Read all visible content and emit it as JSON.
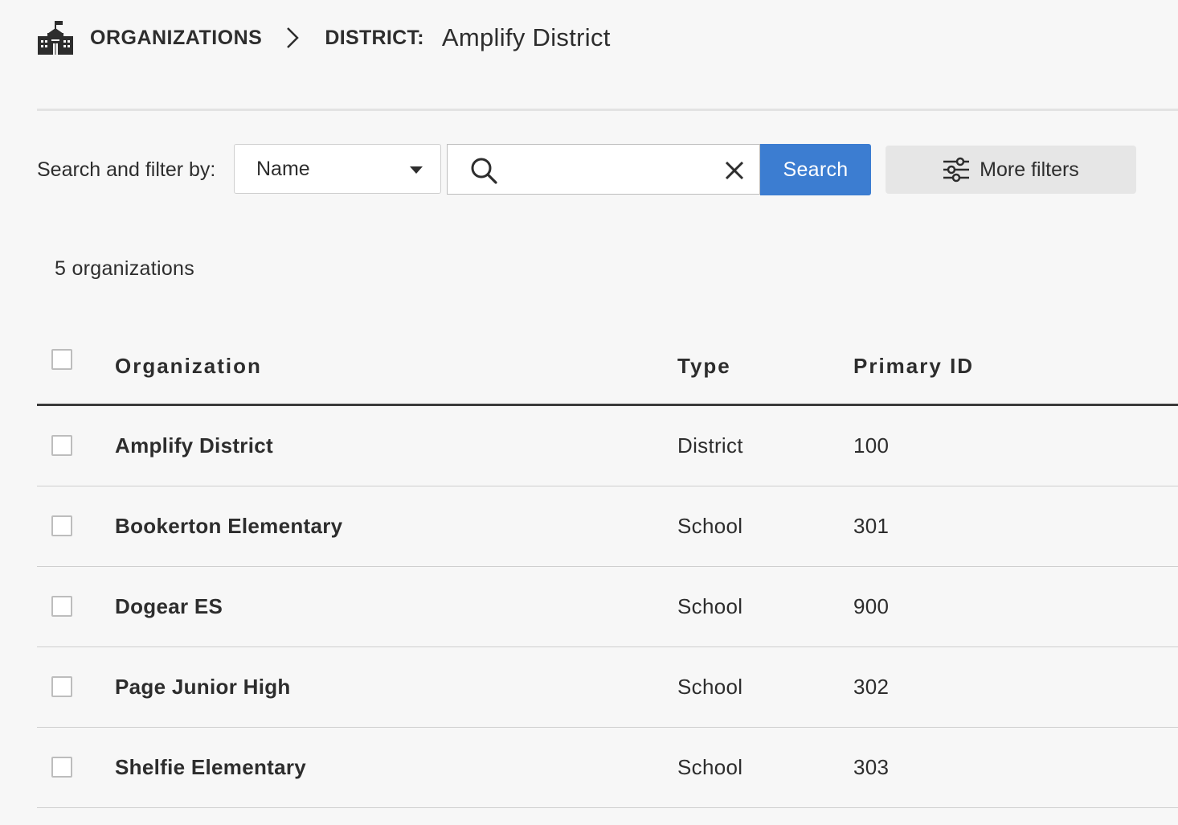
{
  "breadcrumb": {
    "root_label": "ORGANIZATIONS",
    "level_label": "DISTRICT:",
    "current_name": "Amplify District"
  },
  "filter": {
    "label": "Search and filter by:",
    "selected_field": "Name",
    "search_value": "",
    "search_placeholder": "",
    "search_button_label": "Search",
    "more_filters_label": "More filters"
  },
  "summary": {
    "count_text": "5 organizations"
  },
  "table": {
    "columns": {
      "organization": "Organization",
      "type": "Type",
      "primary_id": "Primary ID"
    },
    "rows": [
      {
        "name": "Amplify District",
        "type": "District",
        "primary_id": "100"
      },
      {
        "name": "Bookerton Elementary",
        "type": "School",
        "primary_id": "301"
      },
      {
        "name": "Dogear ES",
        "type": "School",
        "primary_id": "900"
      },
      {
        "name": "Page Junior High",
        "type": "School",
        "primary_id": "302"
      },
      {
        "name": "Shelfie Elementary",
        "type": "School",
        "primary_id": "303"
      }
    ]
  },
  "icons": {
    "header": "school-building-icon",
    "separator": "chevron-right-icon",
    "search": "search-icon",
    "clear": "close-icon",
    "filters": "sliders-icon"
  },
  "colors": {
    "primary_button": "#3c7dd1",
    "background": "#f7f7f7",
    "text": "#2d2d2d"
  }
}
